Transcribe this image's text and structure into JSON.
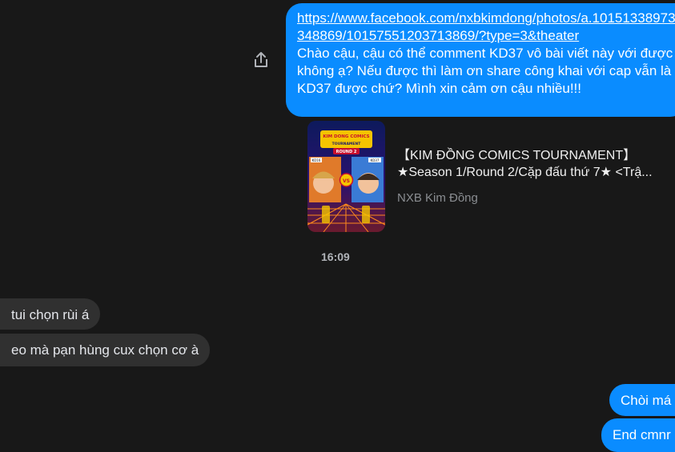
{
  "messages": {
    "first_outgoing": {
      "link": "https://www.facebook.com/nxbkimdong/photos/a.10151338973348869/10157551203713869/?type=3&theater",
      "text": "Chào cậu, cậu có thể comment KD37 vô bài viết này với được không ạ? Nếu được thì làm ơn share công khai với cap vẫn là KD37 được chứ? Mình xin cảm ơn cậu nhiều!!!"
    },
    "link_preview": {
      "title_line1": "【KIM ĐỒNG COMICS TOURNAMENT】",
      "title_line2": "★Season 1/Round 2/Cặp đấu thứ 7★ <Trậ...",
      "source": "NXB Kim Đồng",
      "image": {
        "banner": "KIM DONG COMICS",
        "subtitle": "TOURNAMENT",
        "round": "ROUND 2",
        "left_label": "KD16",
        "right_label": "KD37",
        "vs": "VS"
      }
    },
    "timestamp": "16:09",
    "incoming": [
      {
        "text": "tui chọn rùi á"
      },
      {
        "text": "eo mà pạn hùng cux chọn cơ à"
      }
    ],
    "outgoing_tail": [
      {
        "text": "Chòi má"
      },
      {
        "text": "End cmnr"
      }
    ]
  },
  "icons": {
    "share": "share-icon"
  },
  "colors": {
    "background": "#181818",
    "outgoing_bubble": "#0a8cff",
    "incoming_bubble": "#303030"
  }
}
